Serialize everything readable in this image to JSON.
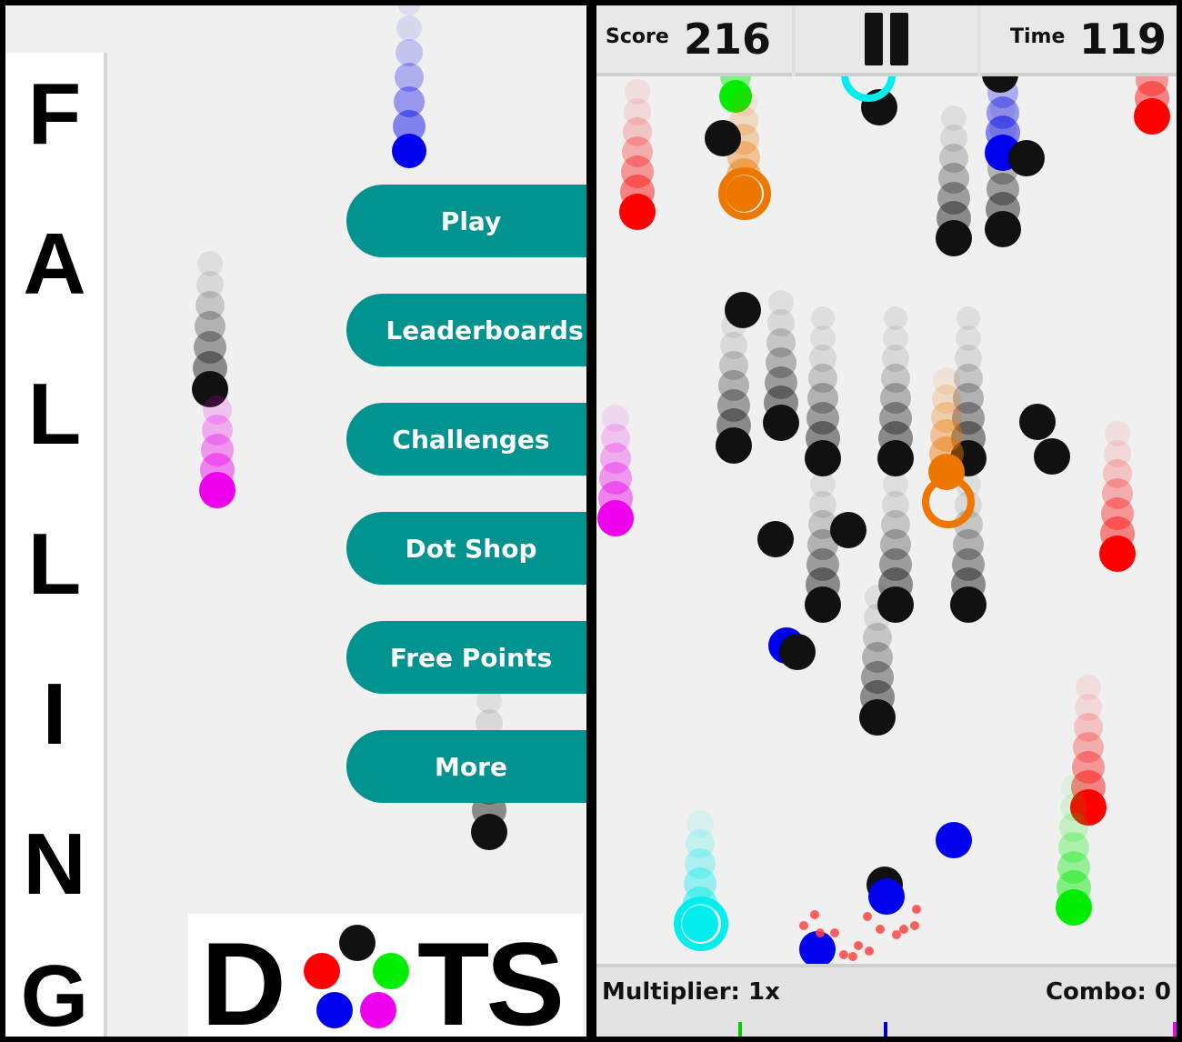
{
  "title": {
    "letters": [
      "F",
      "A",
      "L",
      "L",
      "I",
      "N",
      "G"
    ]
  },
  "menu": {
    "items": [
      {
        "label": "Play"
      },
      {
        "label": "Leaderboards"
      },
      {
        "label": "Challenges"
      },
      {
        "label": "Dot Shop"
      },
      {
        "label": "Free Points"
      },
      {
        "label": "More"
      }
    ]
  },
  "logo": {
    "left_text": "D",
    "right_text": "TS",
    "dot_colors": [
      "#111111",
      "#ff0000",
      "#00ee00",
      "#0000ee",
      "#ee00ee"
    ]
  },
  "hud": {
    "score_label": "Score",
    "score_value": "216",
    "time_label": "Time",
    "time_value": "119",
    "pause_icon": "pause-icon"
  },
  "status": {
    "multiplier_label": "Multiplier: 1x",
    "combo_label": "Combo: 0"
  },
  "colors": {
    "button": "#009390",
    "panel_bg": "#f0f0f0",
    "red": "#ff0000",
    "blue": "#0000ee",
    "green": "#00ee00",
    "magenta": "#ee00ee",
    "black": "#111111",
    "orange": "#ee7700",
    "cyan": "#00eeee"
  }
}
